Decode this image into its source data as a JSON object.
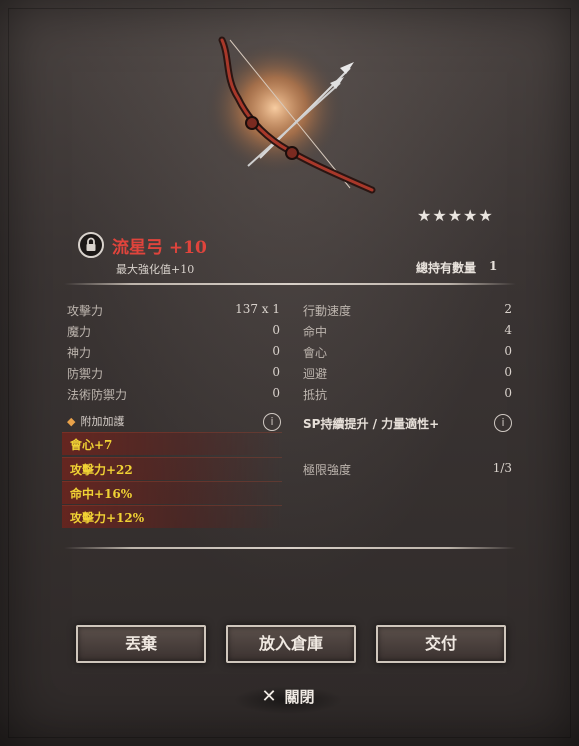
{
  "item": {
    "name": "流星弓 +10",
    "stars": "★★★★★",
    "max_enhance": "最大強化值+10",
    "total_qty_label": "總持有數量",
    "total_qty_value": "1"
  },
  "stats_left": [
    {
      "label": "攻擊力",
      "value": "137 x 1"
    },
    {
      "label": "魔力",
      "value": "0"
    },
    {
      "label": "神力",
      "value": "0"
    },
    {
      "label": "防禦力",
      "value": "0"
    },
    {
      "label": "法術防禦力",
      "value": "0"
    }
  ],
  "stats_right": [
    {
      "label": "行動速度",
      "value": "2"
    },
    {
      "label": "命中",
      "value": "4"
    },
    {
      "label": "會心",
      "value": "0"
    },
    {
      "label": "迴避",
      "value": "0"
    },
    {
      "label": "抵抗",
      "value": "0"
    }
  ],
  "bonus": {
    "header": "附加加護",
    "rows": [
      "會心+7",
      "攻擊力+22",
      "命中+16%",
      "攻擊力+12%"
    ]
  },
  "sp": {
    "text": "SP持續提升 / 力量適性+"
  },
  "limit": {
    "label": "極限強度",
    "value": "1/3"
  },
  "buttons": {
    "discard": "丟棄",
    "store": "放入倉庫",
    "deliver": "交付"
  },
  "close": {
    "label": "關閉"
  },
  "colors": {
    "item_name": "#e0443c",
    "bonus_text": "#f0d234",
    "accent_dot": "#e9a24a"
  },
  "icons": {
    "lock": "lock-icon",
    "info": "info-icon",
    "close": "close-icon"
  }
}
